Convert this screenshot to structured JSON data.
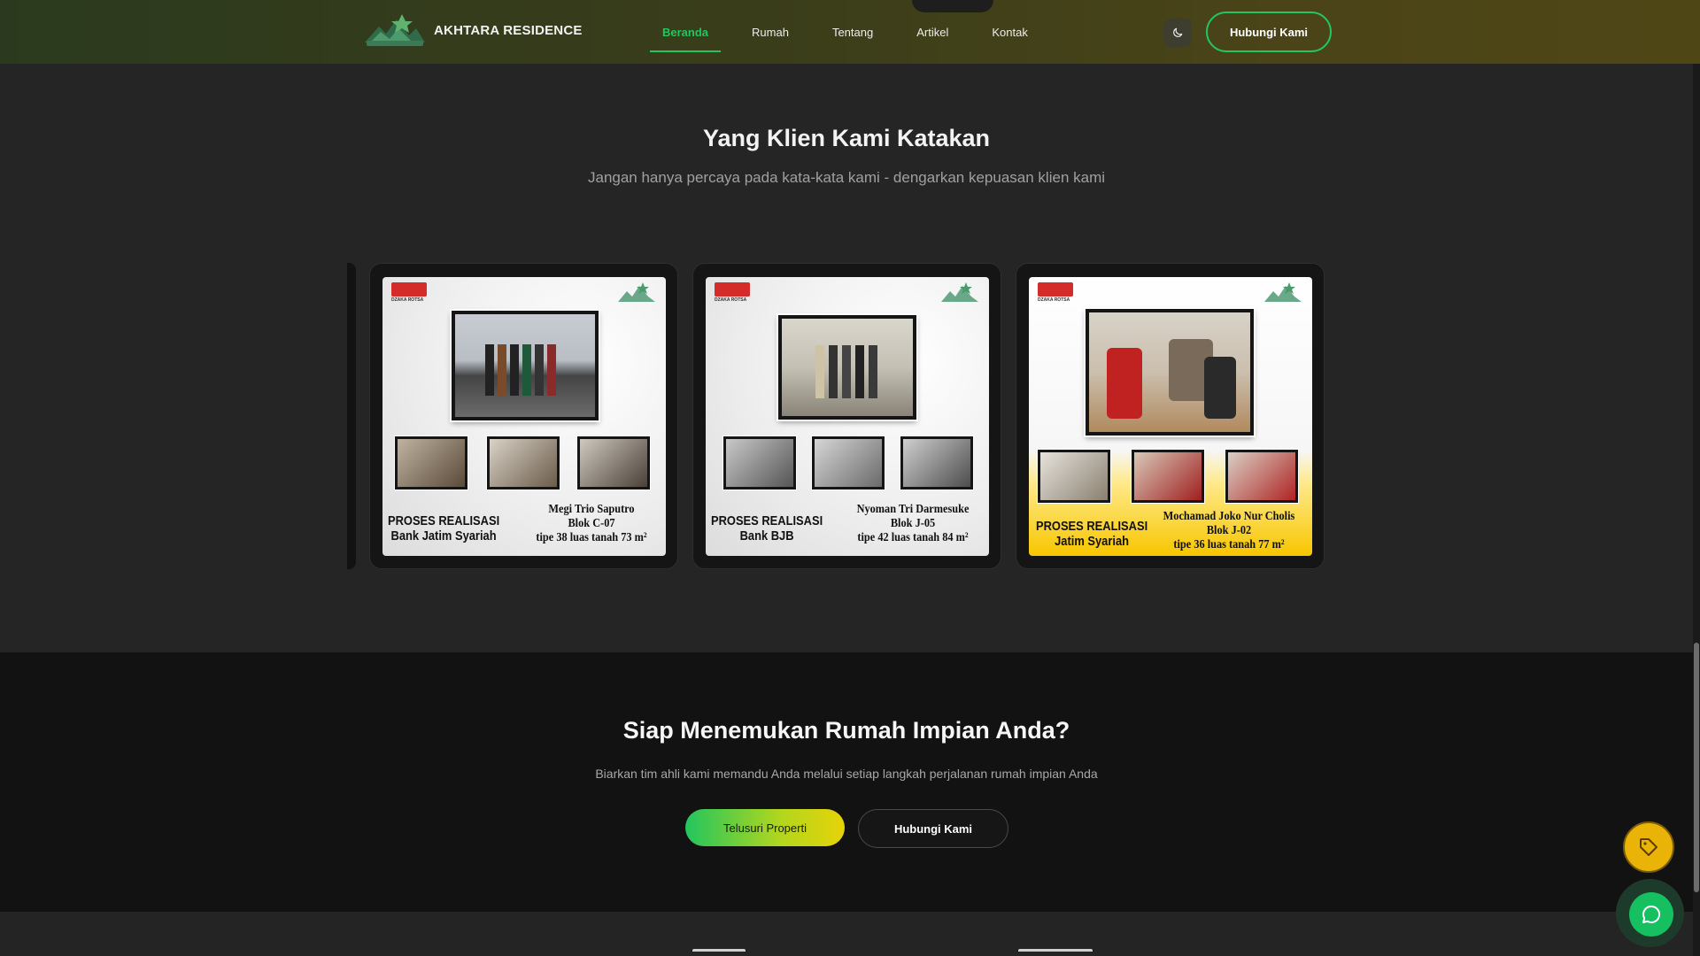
{
  "brand": {
    "name": "AKHTARA RESIDENCE",
    "logo_icon": "akhtara-mountain-logo"
  },
  "nav": {
    "links": [
      {
        "label": "Beranda",
        "active": true
      },
      {
        "label": "Rumah",
        "active": false
      },
      {
        "label": "Tentang",
        "active": false
      },
      {
        "label": "Artikel",
        "active": false
      },
      {
        "label": "Kontak",
        "active": false
      }
    ],
    "theme_icon": "moon-icon",
    "cta_label": "Hubungi Kami"
  },
  "testimonials": {
    "title": "Yang Klien Kami Katakan",
    "subtitle": "Jangan hanya percaya pada kata-kata kami - dengarkan kepuasan klien kami",
    "cards": [
      {
        "developer_logo_text": "DZAKA ROTSA",
        "left_line1": "PROSES REALISASI",
        "left_line2": "Bank Jatim Syariah",
        "name": "Megi Trio Saputro",
        "block": "Blok C-07",
        "detail": "tipe 38 luas tanah 73 m²"
      },
      {
        "developer_logo_text": "DZAKA ROTSA",
        "left_line1": "PROSES REALISASI",
        "left_line2": "Bank BJB",
        "name": "Nyoman Tri Darmesuke",
        "block": "Blok J-05",
        "detail": "tipe 42 luas tanah 84 m²"
      },
      {
        "developer_logo_text": "DZAKA ROTSA",
        "left_line1": "PROSES REALISASI",
        "left_line2": "Jatim Syariah",
        "name": "Mochamad Joko Nur Cholis",
        "block": "Blok J-02",
        "detail": "tipe 36 luas tanah 77 m²"
      }
    ]
  },
  "cta": {
    "title": "Siap Menemukan Rumah Impian Anda?",
    "subtitle": "Biarkan tim ahli kami memandu Anda melalui setiap langkah perjalanan rumah impian Anda",
    "primary_label": "Telusuri Properti",
    "secondary_label": "Hubungi Kami"
  },
  "floating": {
    "tag_icon": "tag-icon",
    "chat_icon": "chat-bubble-icon"
  },
  "colors": {
    "accent_green": "#22c55e",
    "accent_yellow": "#eab308",
    "page_bg": "#252525",
    "cta_bg": "#121212"
  }
}
